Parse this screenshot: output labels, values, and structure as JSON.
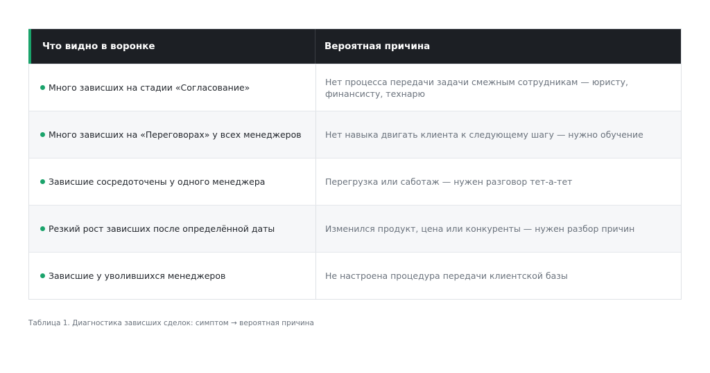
{
  "table": {
    "headers": {
      "symptom": "Что видно в воронке",
      "cause": "Вероятная причина"
    },
    "rows": [
      {
        "symptom": "Много зависших на стадии «Согласование»",
        "cause": "Нет процесса передачи задачи смежным сотрудникам — юристу, финансисту, технарю"
      },
      {
        "symptom": "Много зависших на «Переговорах» у всех менеджеров",
        "cause": "Нет навыка двигать клиента к следующему шагу — нужно обучение"
      },
      {
        "symptom": "Зависшие сосредоточены у одного менеджера",
        "cause": "Перегрузка или саботаж — нужен разговор тет-а-тет"
      },
      {
        "symptom": "Резкий рост зависших после определённой даты",
        "cause": "Изменился продукт, цена или конкуренты — нужен разбор причин"
      },
      {
        "symptom": "Зависшие у уволившихся менеджеров",
        "cause": "Не настроена процедура передачи клиентской базы"
      }
    ],
    "caption": "Таблица 1. Диагностика зависших сделок: симптом → вероятная причина"
  },
  "colors": {
    "header_bg": "#1c1f24",
    "accent": "#1aa36b",
    "alt_row_bg": "#f6f7f9"
  },
  "icons": {
    "row_marker": "green-dot-icon"
  }
}
